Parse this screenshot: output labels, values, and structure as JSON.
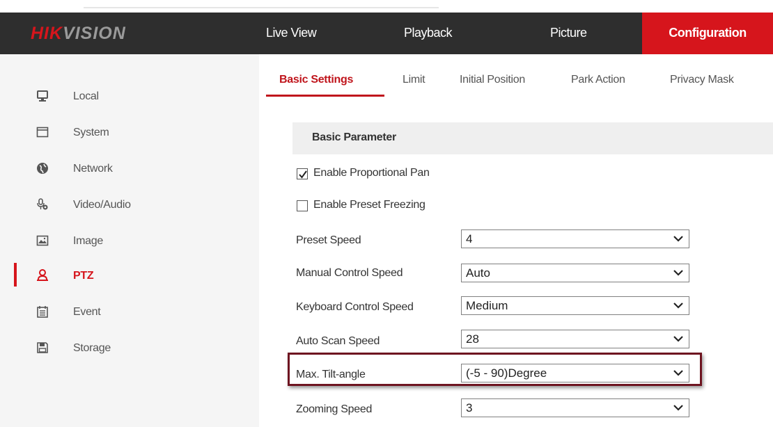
{
  "brand": {
    "logo_red": "HIK",
    "logo_gray": "VISION"
  },
  "colors": {
    "accent": "#d6151c",
    "header_bg": "#2e2e2e",
    "sidebar_bg": "#f5f5f5",
    "highlight_border": "#6e1420"
  },
  "nav": {
    "live_view": "Live View",
    "playback": "Playback",
    "picture": "Picture",
    "configuration": "Configuration",
    "active": "Configuration"
  },
  "sidebar": {
    "items": [
      {
        "label": "Local",
        "icon": "monitor-icon"
      },
      {
        "label": "System",
        "icon": "window-icon"
      },
      {
        "label": "Network",
        "icon": "globe-icon"
      },
      {
        "label": "Video/Audio",
        "icon": "microphone-icon"
      },
      {
        "label": "Image",
        "icon": "image-icon"
      },
      {
        "label": "PTZ",
        "icon": "ptz-person-icon",
        "active": true
      },
      {
        "label": "Event",
        "icon": "calendar-icon"
      },
      {
        "label": "Storage",
        "icon": "floppy-icon"
      }
    ]
  },
  "tabs": {
    "basic_settings": "Basic Settings",
    "limit": "Limit",
    "initial_position": "Initial Position",
    "park_action": "Park Action",
    "privacy_mask": "Privacy Mask",
    "active": "Basic Settings"
  },
  "section": {
    "title": "Basic Parameter"
  },
  "checkboxes": {
    "proportional_pan": {
      "label": "Enable Proportional Pan",
      "checked": true
    },
    "preset_freezing": {
      "label": "Enable Preset Freezing",
      "checked": false
    }
  },
  "fields": {
    "preset_speed": {
      "label": "Preset Speed",
      "value": "4"
    },
    "manual_control_speed": {
      "label": "Manual Control Speed",
      "value": "Auto"
    },
    "keyboard_control_speed": {
      "label": "Keyboard Control Speed",
      "value": "Medium"
    },
    "auto_scan_speed": {
      "label": "Auto Scan Speed",
      "value": "28"
    },
    "max_tilt_angle": {
      "label": "Max. Tilt-angle",
      "value": "(-5 - 90)Degree",
      "highlighted": true
    },
    "zooming_speed": {
      "label": "Zooming Speed",
      "value": "3"
    }
  }
}
